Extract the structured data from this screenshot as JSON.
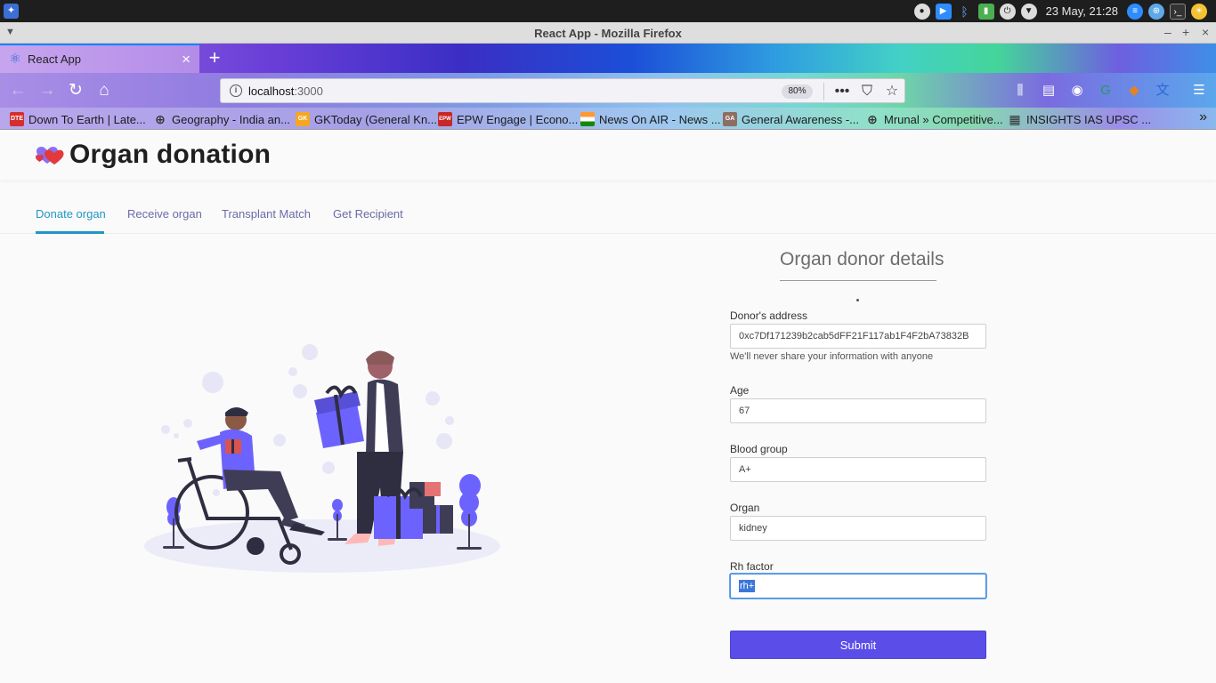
{
  "os": {
    "clock": "23 May, 21:28",
    "tray_icons": [
      "notification-icon",
      "zoom-icon",
      "bluetooth-icon",
      "network-icon",
      "power-icon",
      "vpn-icon",
      "workspace-icon",
      "globe-icon",
      "terminal-icon",
      "weather-icon"
    ]
  },
  "window": {
    "title": "React App - Mozilla Firefox"
  },
  "browser": {
    "tab_label": "React App",
    "url_host": "localhost",
    "url_port": ":3000",
    "zoom": "80%",
    "bookmarks": [
      {
        "label": "Down To Earth | Late...",
        "icon": "DTE",
        "color": "#d32f2f"
      },
      {
        "label": "Geography - India an...",
        "icon": "globe",
        "color": "#777777"
      },
      {
        "label": "GKToday (General Kn...",
        "icon": "GK",
        "color": "#f5a623"
      },
      {
        "label": "EPW Engage | Econo...",
        "icon": "EPW",
        "color": "#c62828"
      },
      {
        "label": "News On AIR - News ...",
        "icon": "flag",
        "color": "#ff9933"
      },
      {
        "label": "General Awareness -...",
        "icon": "GA",
        "color": "#8d6e63"
      },
      {
        "label": "Mrunal » Competitive...",
        "icon": "globe",
        "color": "#777777"
      },
      {
        "label": "INSIGHTS IAS UPSC ...",
        "icon": "grid",
        "color": "#444444"
      }
    ]
  },
  "app": {
    "title": "Organ donation",
    "tabs": [
      "Donate organ",
      "Receive organ",
      "Transplant Match",
      "Get Recipient"
    ],
    "active_tab": "Donate organ",
    "form": {
      "title": "Organ donor details",
      "address_label": "Donor's address",
      "address_value": "0xc7Df171239b2cab5dFF21F117ab1F4F2bA73832B",
      "address_help": "We'll never share your information with anyone",
      "age_label": "Age",
      "age_value": "67",
      "blood_label": "Blood group",
      "blood_value": "A+",
      "organ_label": "Organ",
      "organ_value": "kidney",
      "rh_label": "Rh factor",
      "rh_value": "rh+",
      "submit_label": "Submit"
    }
  },
  "colors": {
    "accent": "#2196c4",
    "tab_text": "#6b6ba8",
    "submit": "#5b4ee8",
    "illustration": "#6c63ff"
  }
}
